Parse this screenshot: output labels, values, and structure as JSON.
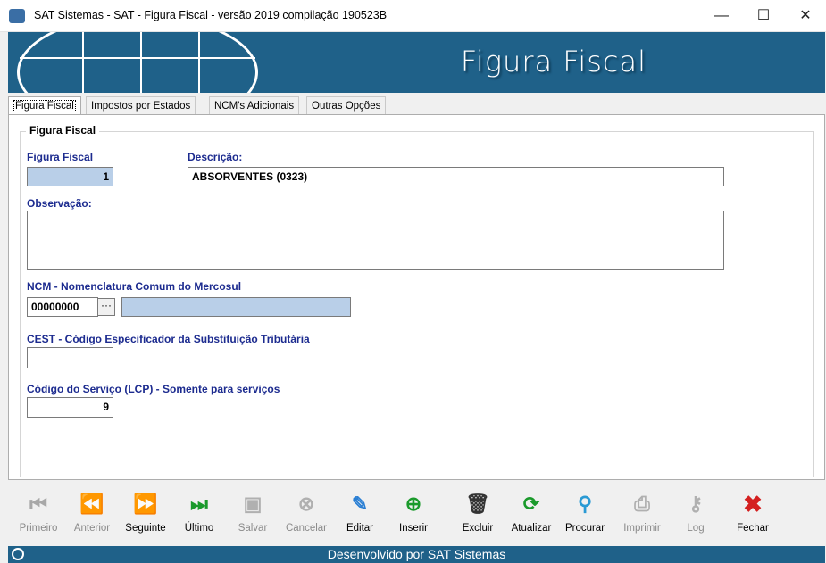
{
  "window": {
    "title": "SAT Sistemas - SAT - Figura Fiscal - versão 2019 compilação 190523B",
    "minimize_glyph": "—",
    "maximize_glyph": "☐",
    "close_glyph": "✕"
  },
  "banner": {
    "heading": "Figura Fiscal"
  },
  "tabs": [
    {
      "label": "Figura Fiscal"
    },
    {
      "label": "Impostos por Estados"
    },
    {
      "label": "NCM's Adicionais"
    },
    {
      "label": "Outras Opções"
    }
  ],
  "form": {
    "group_title": "Figura Fiscal",
    "figura_label": "Figura Fiscal",
    "figura_value": "1",
    "descricao_label": "Descrição:",
    "descricao_value": "ABSORVENTES (0323)",
    "observacao_label": "Observação:",
    "observacao_value": "",
    "ncm_label": "NCM - Nomenclatura Comum do Mercosul",
    "ncm_value": "00000000",
    "ncm_button": "···",
    "ncm_desc_value": "",
    "cest_label": "CEST - Código Especificador da Substituição Tributária",
    "cest_value": "",
    "lcp_label": "Código do Serviço (LCP) - Somente para serviços",
    "lcp_value": "9"
  },
  "toolbar": [
    {
      "label": "Primeiro",
      "icon": "first-icon",
      "enabled": false
    },
    {
      "label": "Anterior",
      "icon": "previous-icon",
      "enabled": false
    },
    {
      "label": "Seguinte",
      "icon": "next-icon",
      "enabled": true
    },
    {
      "label": "Último",
      "icon": "last-icon",
      "enabled": true
    },
    {
      "label": "Salvar",
      "icon": "save-icon",
      "enabled": false
    },
    {
      "label": "Cancelar",
      "icon": "cancel-icon",
      "enabled": false
    },
    {
      "label": "Editar",
      "icon": "edit-icon",
      "enabled": true
    },
    {
      "label": "Inserir",
      "icon": "insert-icon",
      "enabled": true
    },
    {
      "label": "Excluir",
      "icon": "delete-icon",
      "enabled": true
    },
    {
      "label": "Atualizar",
      "icon": "refresh-icon",
      "enabled": true
    },
    {
      "label": "Procurar",
      "icon": "search-icon",
      "enabled": true
    },
    {
      "label": "Imprimir",
      "icon": "print-icon",
      "enabled": false
    },
    {
      "label": "Log",
      "icon": "log-icon",
      "enabled": false
    },
    {
      "label": "Fechar",
      "icon": "close-icon",
      "enabled": true
    }
  ],
  "footer": {
    "text": "Desenvolvido por SAT Sistemas"
  },
  "colors": {
    "brand": "#1f6189",
    "field_blue": "#b9cfe8",
    "label_blue": "#1c2b8f"
  }
}
